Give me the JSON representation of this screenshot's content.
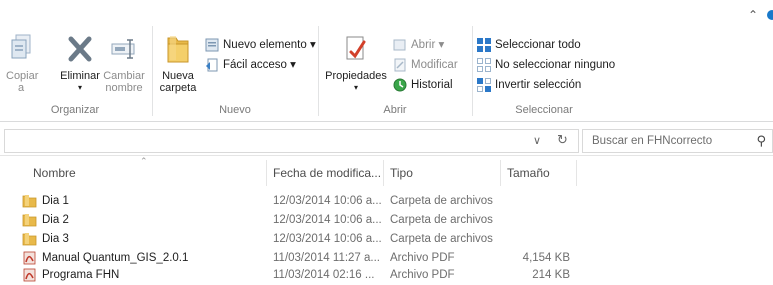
{
  "ribbon": {
    "organizar": {
      "label": "Organizar",
      "copy": {
        "line1": "Copiar",
        "line2": "a",
        "icon": "copy-to-icon"
      },
      "delete": {
        "label": "Eliminar",
        "icon": "delete-x-icon"
      },
      "rename": {
        "line1": "Cambiar",
        "line2": "nombre",
        "icon": "rename-icon"
      }
    },
    "nuevo": {
      "label": "Nuevo",
      "new_folder": {
        "line1": "Nueva",
        "line2": "carpeta",
        "icon": "new-folder-icon"
      },
      "new_item": "Nuevo elemento ▾",
      "easy_access": "Fácil acceso ▾"
    },
    "abrir": {
      "label": "Abrir",
      "properties": "Propiedades",
      "open": "Abrir ▾",
      "edit": "Modificar",
      "history": "Historial"
    },
    "seleccionar": {
      "label": "Seleccionar",
      "select_all": "Seleccionar todo",
      "select_none": "No seleccionar ninguno",
      "invert": "Invertir selección"
    }
  },
  "address_bar": {
    "dropdown": "∨",
    "refresh": "↻"
  },
  "search": {
    "placeholder": "Buscar en FHNcorrecto",
    "icon": "search-icon"
  },
  "columns": {
    "name": "Nombre",
    "date": "Fecha de modifica...",
    "type": "Tipo",
    "size": "Tamaño"
  },
  "files": [
    {
      "name": "Dia 1",
      "date": "12/03/2014 10:06 a...",
      "type": "Carpeta de archivos",
      "size": "",
      "icon": "folder-icon"
    },
    {
      "name": "Dia 2",
      "date": "12/03/2014 10:06 a...",
      "type": "Carpeta de archivos",
      "size": "",
      "icon": "folder-icon"
    },
    {
      "name": "Dia 3",
      "date": "12/03/2014 10:06 a...",
      "type": "Carpeta de archivos",
      "size": "",
      "icon": "folder-icon"
    },
    {
      "name": "Manual Quantum_GIS_2.0.1",
      "date": "11/03/2014 11:27 a...",
      "type": "Archivo PDF",
      "size": "4,154 KB",
      "icon": "pdf-icon"
    },
    {
      "name": "Programa FHN",
      "date": "11/03/2014 02:16 ...",
      "type": "Archivo PDF",
      "size": "214 KB",
      "icon": "pdf-icon"
    }
  ]
}
